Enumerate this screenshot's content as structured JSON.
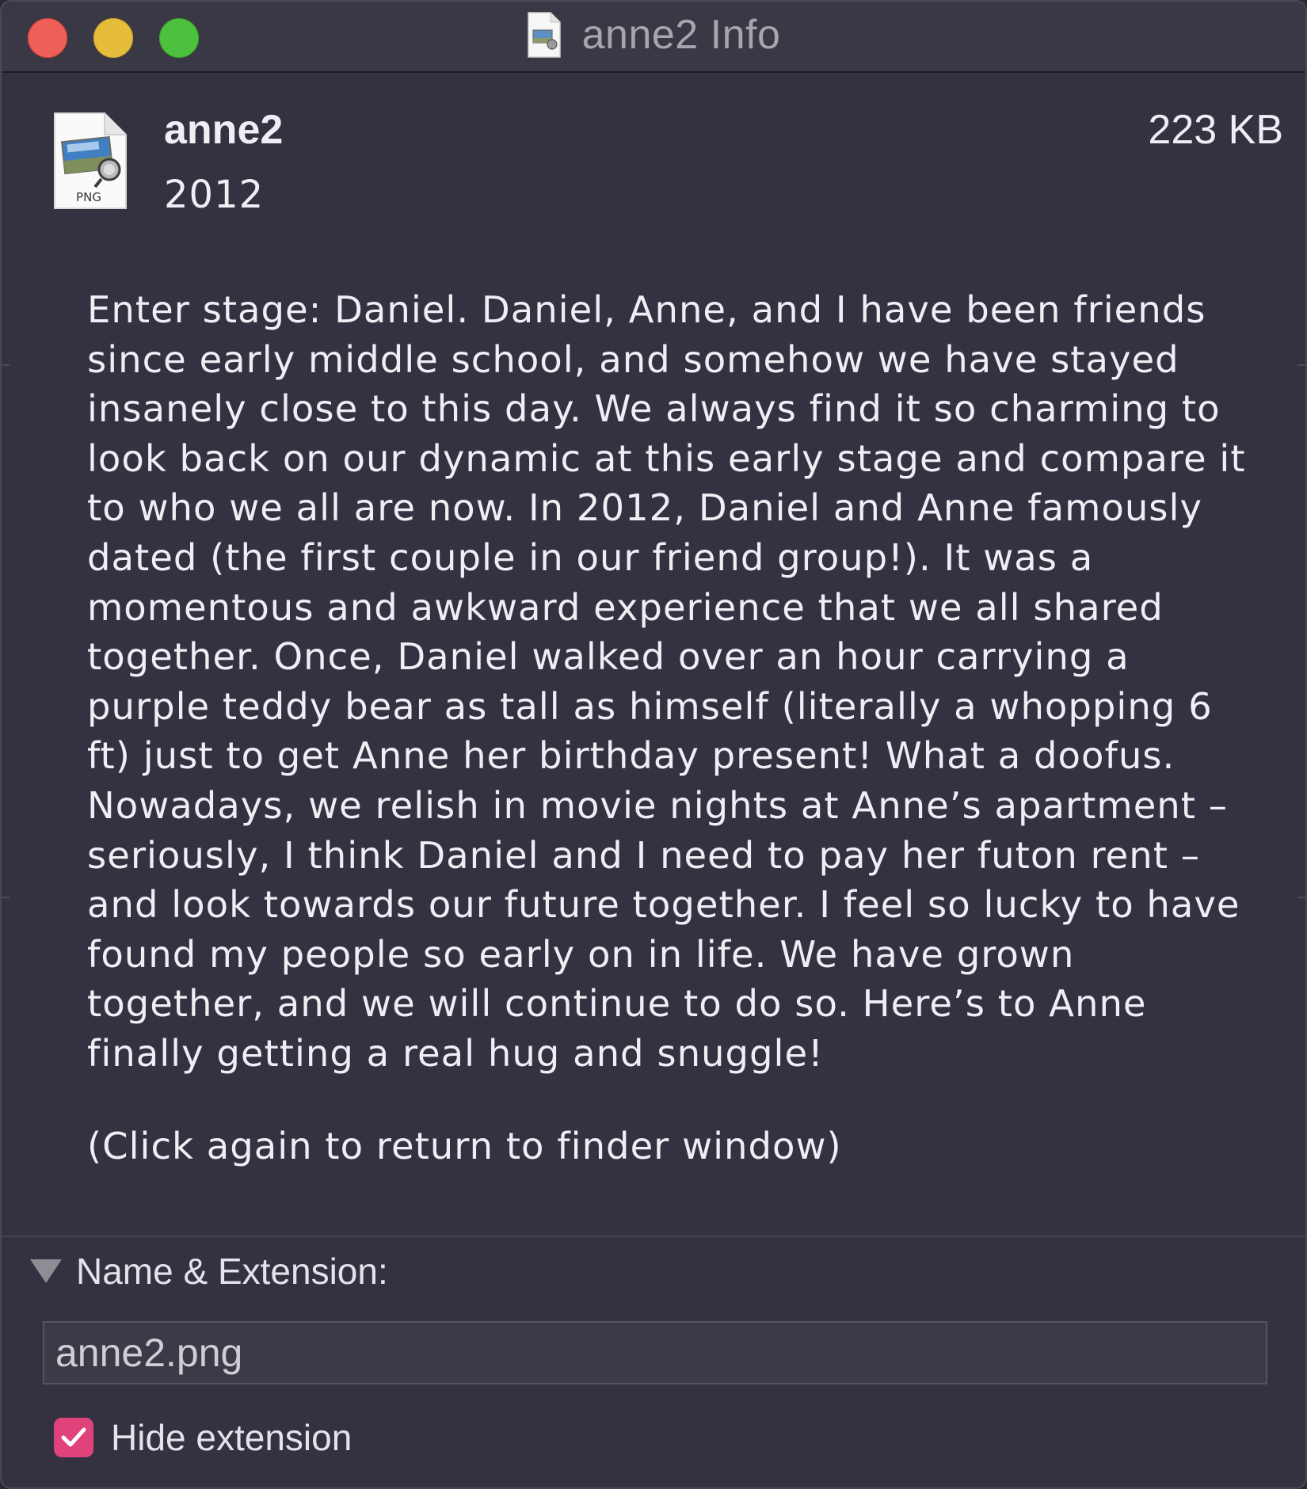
{
  "window": {
    "title": "anne2 Info"
  },
  "header": {
    "file_name": "anne2",
    "year": "2012",
    "size": "223 KB",
    "icon_badge": "PNG"
  },
  "comment": {
    "text": "Enter stage: Daniel. Daniel, Anne, and I have been friends since early middle school, and somehow we have stayed insanely close to this day. We always find it so charming to look back on our dynamic at this early stage and compare it to who we all are now. In 2012, Daniel and Anne famously dated (the first couple in our friend group!). It was a momentous and awkward experience that we all shared together. Once, Daniel walked over an hour carrying a purple teddy bear as tall as himself (literally a whopping 6 ft) just to get Anne her birthday present! What a doofus. Nowadays, we relish in movie nights at Anne’s apartment – seriously, I think Daniel and I need to pay her futon rent – and look towards our future together. I feel so lucky to have found my people so early on in life. We have grown together, and we will continue to do so. Here’s to Anne finally getting a real hug and snuggle!",
    "hint": "(Click again to return to finder window)"
  },
  "name_extension": {
    "section_label": "Name & Extension:",
    "field_value": "anne2.png",
    "hide_extension_label": "Hide extension",
    "hide_extension_checked": true
  },
  "colors": {
    "window_bg": "#343240",
    "close": "#ed5f57",
    "minimize": "#e6bd3b",
    "zoom": "#4dc13d",
    "checkbox_accent": "#e0427b",
    "text": "#f0eef4"
  },
  "icons": [
    "png-document-icon",
    "disclosure-triangle-icon",
    "checkmark-icon"
  ]
}
